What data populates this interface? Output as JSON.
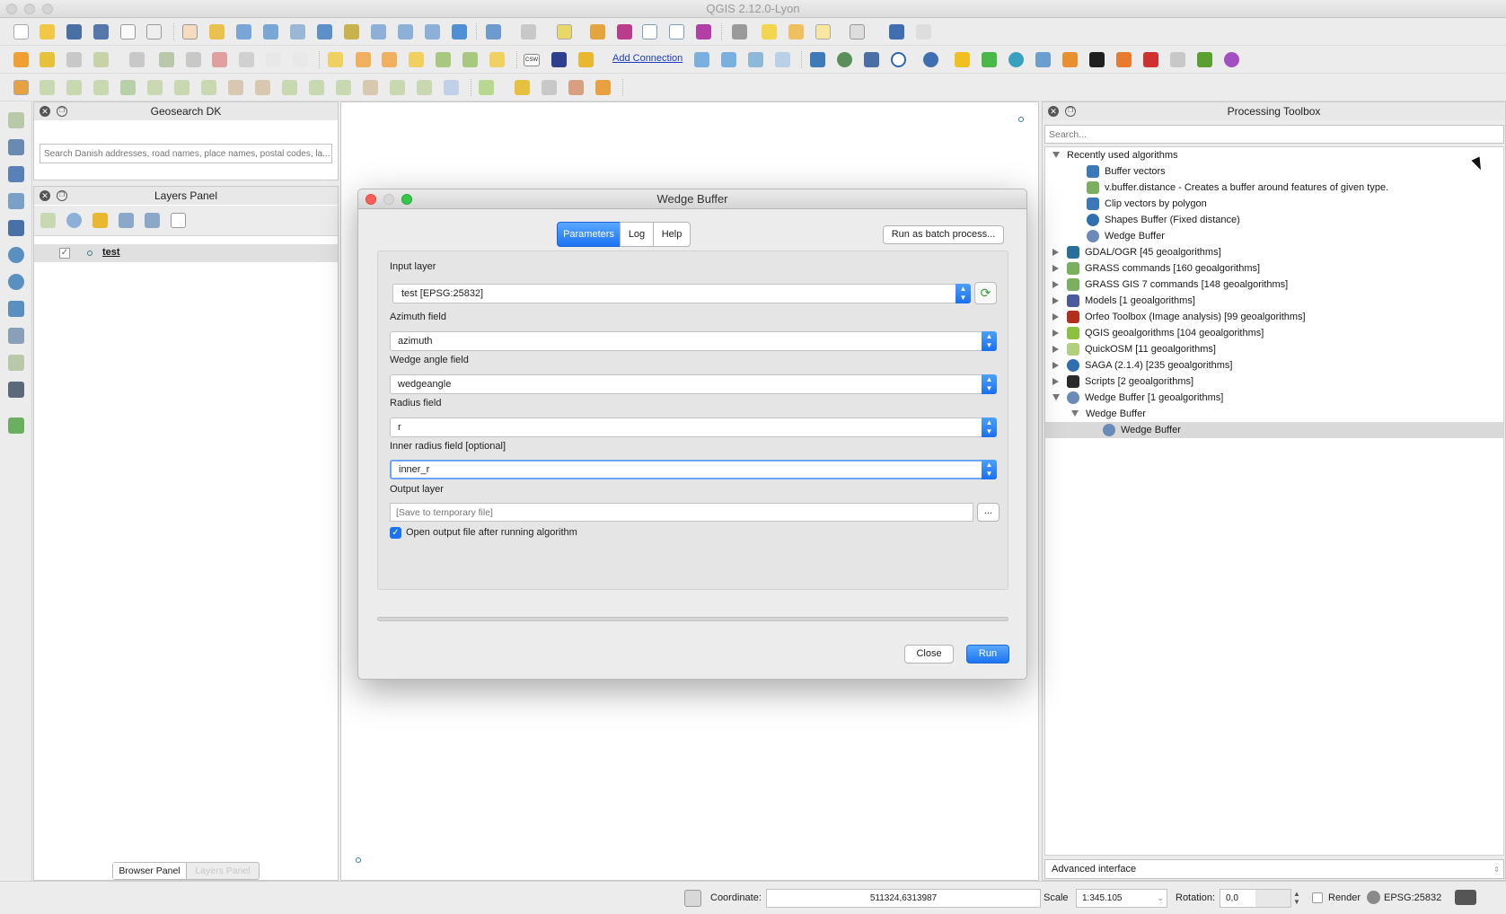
{
  "app": {
    "window_title": "QGIS 2.12.0-Lyon"
  },
  "toolbar": {
    "add_connection_label": "Add Connection",
    "csw_label": "CSW"
  },
  "geosearch_panel": {
    "title": "Geosearch DK",
    "search_placeholder": "Search Danish addresses, road names, place names, postal codes, la..."
  },
  "layers_panel": {
    "title": "Layers Panel",
    "layers": [
      {
        "name": "test",
        "checked": true
      }
    ],
    "bottom_tabs": [
      "Browser Panel",
      "Layers Panel"
    ]
  },
  "processing_toolbox": {
    "title": "Processing Toolbox",
    "search_placeholder": "Search...",
    "tree": [
      {
        "label": "Recently used algorithms",
        "expanded": true,
        "icon": "none"
      },
      {
        "label": "Buffer vectors",
        "icon": "qgis-python-icon"
      },
      {
        "label": "v.buffer.distance - Creates a buffer around features of given type.",
        "icon": "grass-icon"
      },
      {
        "label": "Clip vectors by polygon",
        "icon": "qgis-python-icon"
      },
      {
        "label": "Shapes Buffer (Fixed distance)",
        "icon": "saga-icon"
      },
      {
        "label": "Wedge Buffer",
        "icon": "gear-icon"
      },
      {
        "label": "GDAL/OGR [45 geoalgorithms]",
        "expanded": false,
        "icon": "gdal-icon"
      },
      {
        "label": "GRASS commands [160 geoalgorithms]",
        "expanded": false,
        "icon": "grass-icon"
      },
      {
        "label": "GRASS GIS 7 commands [148 geoalgorithms]",
        "expanded": false,
        "icon": "grass-icon"
      },
      {
        "label": "Models [1 geoalgorithms]",
        "expanded": false,
        "icon": "models-icon"
      },
      {
        "label": "Orfeo Toolbox (Image analysis) [99 geoalgorithms]",
        "expanded": false,
        "icon": "orfeo-icon"
      },
      {
        "label": "QGIS geoalgorithms [104 geoalgorithms]",
        "expanded": false,
        "icon": "qgis-icon"
      },
      {
        "label": "QuickOSM [11 geoalgorithms]",
        "expanded": false,
        "icon": "quickosm-icon"
      },
      {
        "label": "SAGA (2.1.4) [235 geoalgorithms]",
        "expanded": false,
        "icon": "saga-icon"
      },
      {
        "label": "Scripts [2 geoalgorithms]",
        "expanded": false,
        "icon": "scripts-icon"
      },
      {
        "label": "Wedge Buffer [1 geoalgorithms]",
        "expanded": true,
        "icon": "gear-icon"
      },
      {
        "label": "Wedge Buffer",
        "expanded": true,
        "icon": "none"
      },
      {
        "label": "Wedge Buffer",
        "icon": "gear-icon",
        "selected": true
      }
    ],
    "advanced_interface_label": "Advanced interface"
  },
  "dialog": {
    "title": "Wedge Buffer",
    "tabs": [
      "Parameters",
      "Log",
      "Help"
    ],
    "active_tab": "Parameters",
    "batch_button": "Run as batch process...",
    "fields": {
      "input_layer_label": "Input layer",
      "input_layer_value": "test [EPSG:25832]",
      "azimuth_label": "Azimuth field",
      "azimuth_value": "azimuth",
      "wedge_angle_label": "Wedge angle field",
      "wedge_angle_value": "wedgeangle",
      "radius_label": "Radius field",
      "radius_value": "r",
      "inner_radius_label": "Inner radius field [optional]",
      "inner_radius_value": "inner_r",
      "output_label": "Output layer",
      "output_placeholder": "[Save to temporary file]",
      "browse_label": "...",
      "open_output_label": "Open output file after running algorithm",
      "open_output_checked": true
    },
    "progress": 0,
    "close_button": "Close",
    "run_button": "Run"
  },
  "statusbar": {
    "coordinate_label": "Coordinate:",
    "coordinate_value": "511324,6313987",
    "scale_label": "Scale",
    "scale_value": "1:345.105",
    "rotation_label": "Rotation:",
    "rotation_value": "0,0",
    "render_label": "Render",
    "render_checked": false,
    "crs_label": "EPSG:25832"
  },
  "colors": {
    "accent_blue": "#1b73f2",
    "panel_header": "#e8e8e8",
    "selected_row": "#d9d9d9"
  }
}
